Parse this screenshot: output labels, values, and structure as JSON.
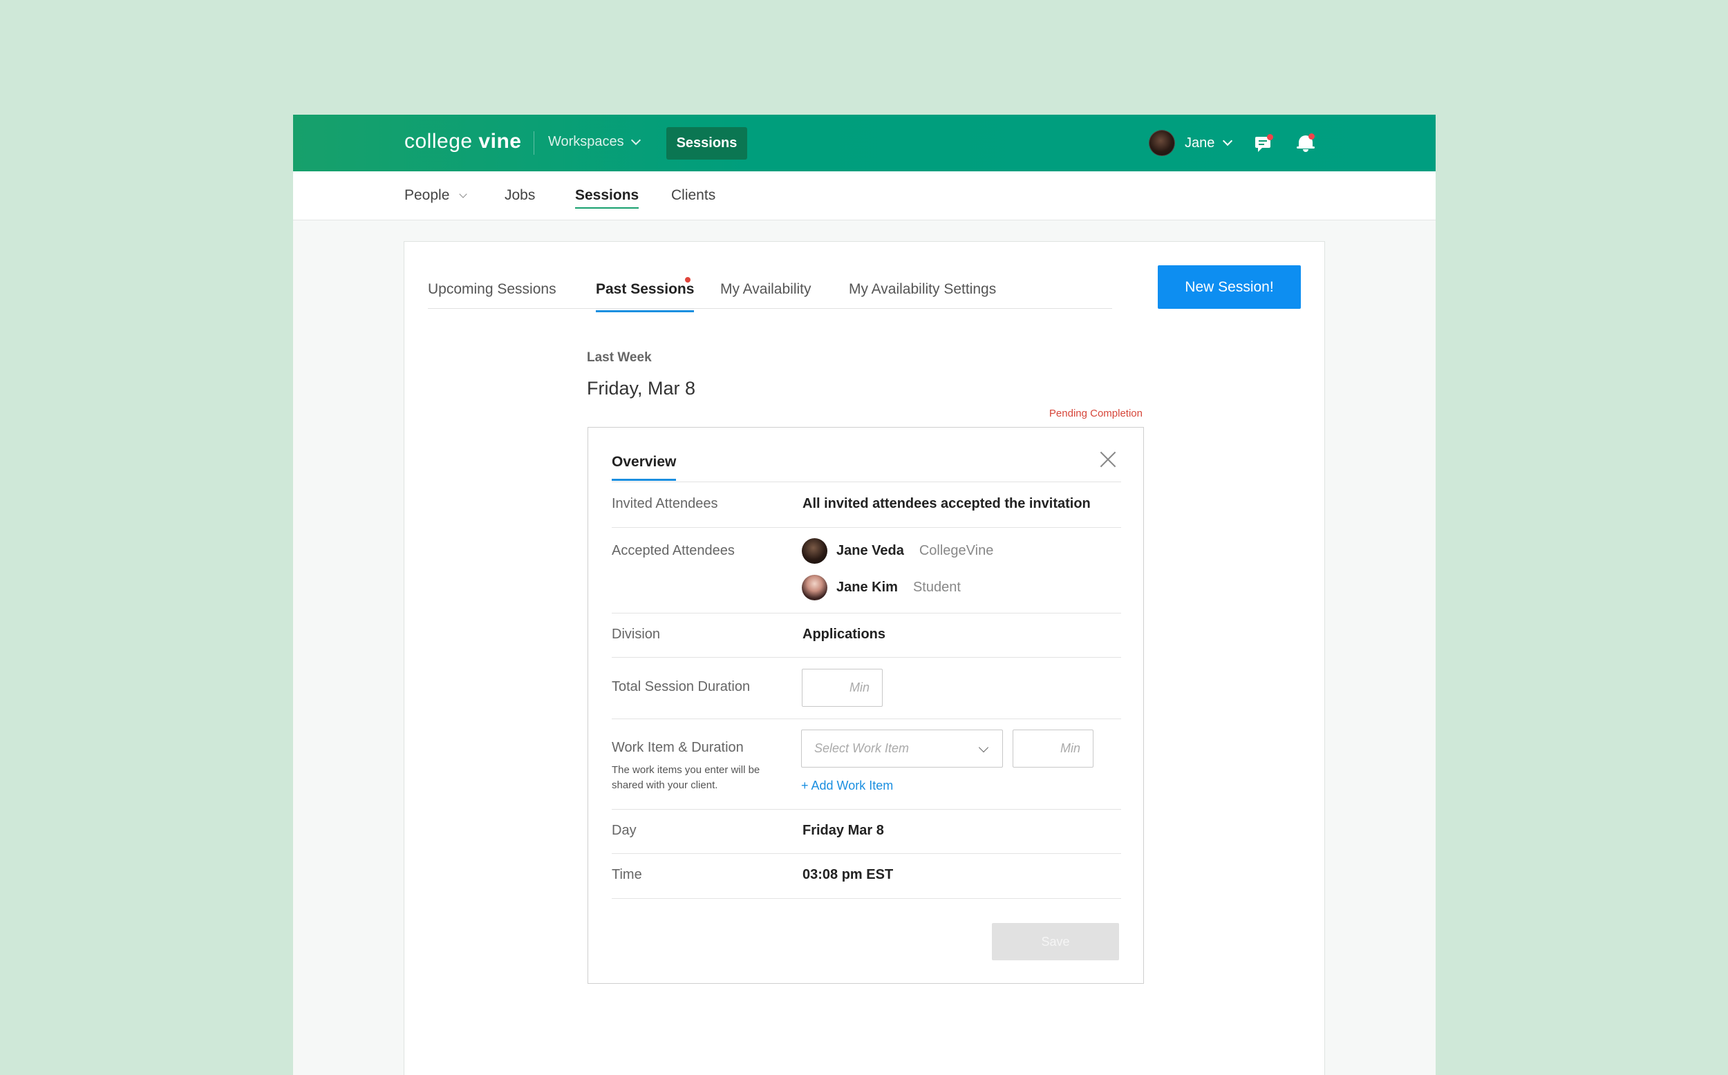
{
  "header": {
    "logo_light": "college",
    "logo_bold": "vine",
    "workspaces_label": "Workspaces",
    "sessions_button": "Sessions",
    "user_name": "Jane"
  },
  "subnav": {
    "people": "People",
    "jobs": "Jobs",
    "sessions": "Sessions",
    "clients": "Clients"
  },
  "tabs": {
    "upcoming": "Upcoming Sessions",
    "past": "Past Sessions",
    "availability": "My Availability",
    "availability_settings": "My Availability Settings"
  },
  "new_session_button": "New Session!",
  "period_label": "Last Week",
  "date_heading": "Friday, Mar 8",
  "status": "Pending Completion",
  "overview": {
    "tab_label": "Overview",
    "invited_label": "Invited Attendees",
    "invited_value": "All invited attendees accepted the invitation",
    "accepted_label": "Accepted Attendees",
    "attendees": [
      {
        "name": "Jane Veda",
        "org": "CollegeVine"
      },
      {
        "name": "Jane Kim",
        "org": "Student"
      }
    ],
    "division_label": "Division",
    "division_value": "Applications",
    "total_duration_label": "Total Session Duration",
    "min_placeholder": "Min",
    "work_item_label": "Work Item & Duration",
    "work_item_help": "The work items you enter will be shared with your client.",
    "work_item_placeholder": "Select Work Item",
    "add_work_item": "+ Add Work Item",
    "day_label": "Day",
    "day_value": "Friday Mar 8",
    "time_label": "Time",
    "time_value": "03:08 pm EST",
    "save_button": "Save"
  },
  "colors": {
    "topbar": "#009e7c",
    "active_sessions_btn": "#0b7652",
    "primary_blue": "#0d8ef1",
    "status_red": "#d6463a",
    "background": "#cfe8d8"
  }
}
